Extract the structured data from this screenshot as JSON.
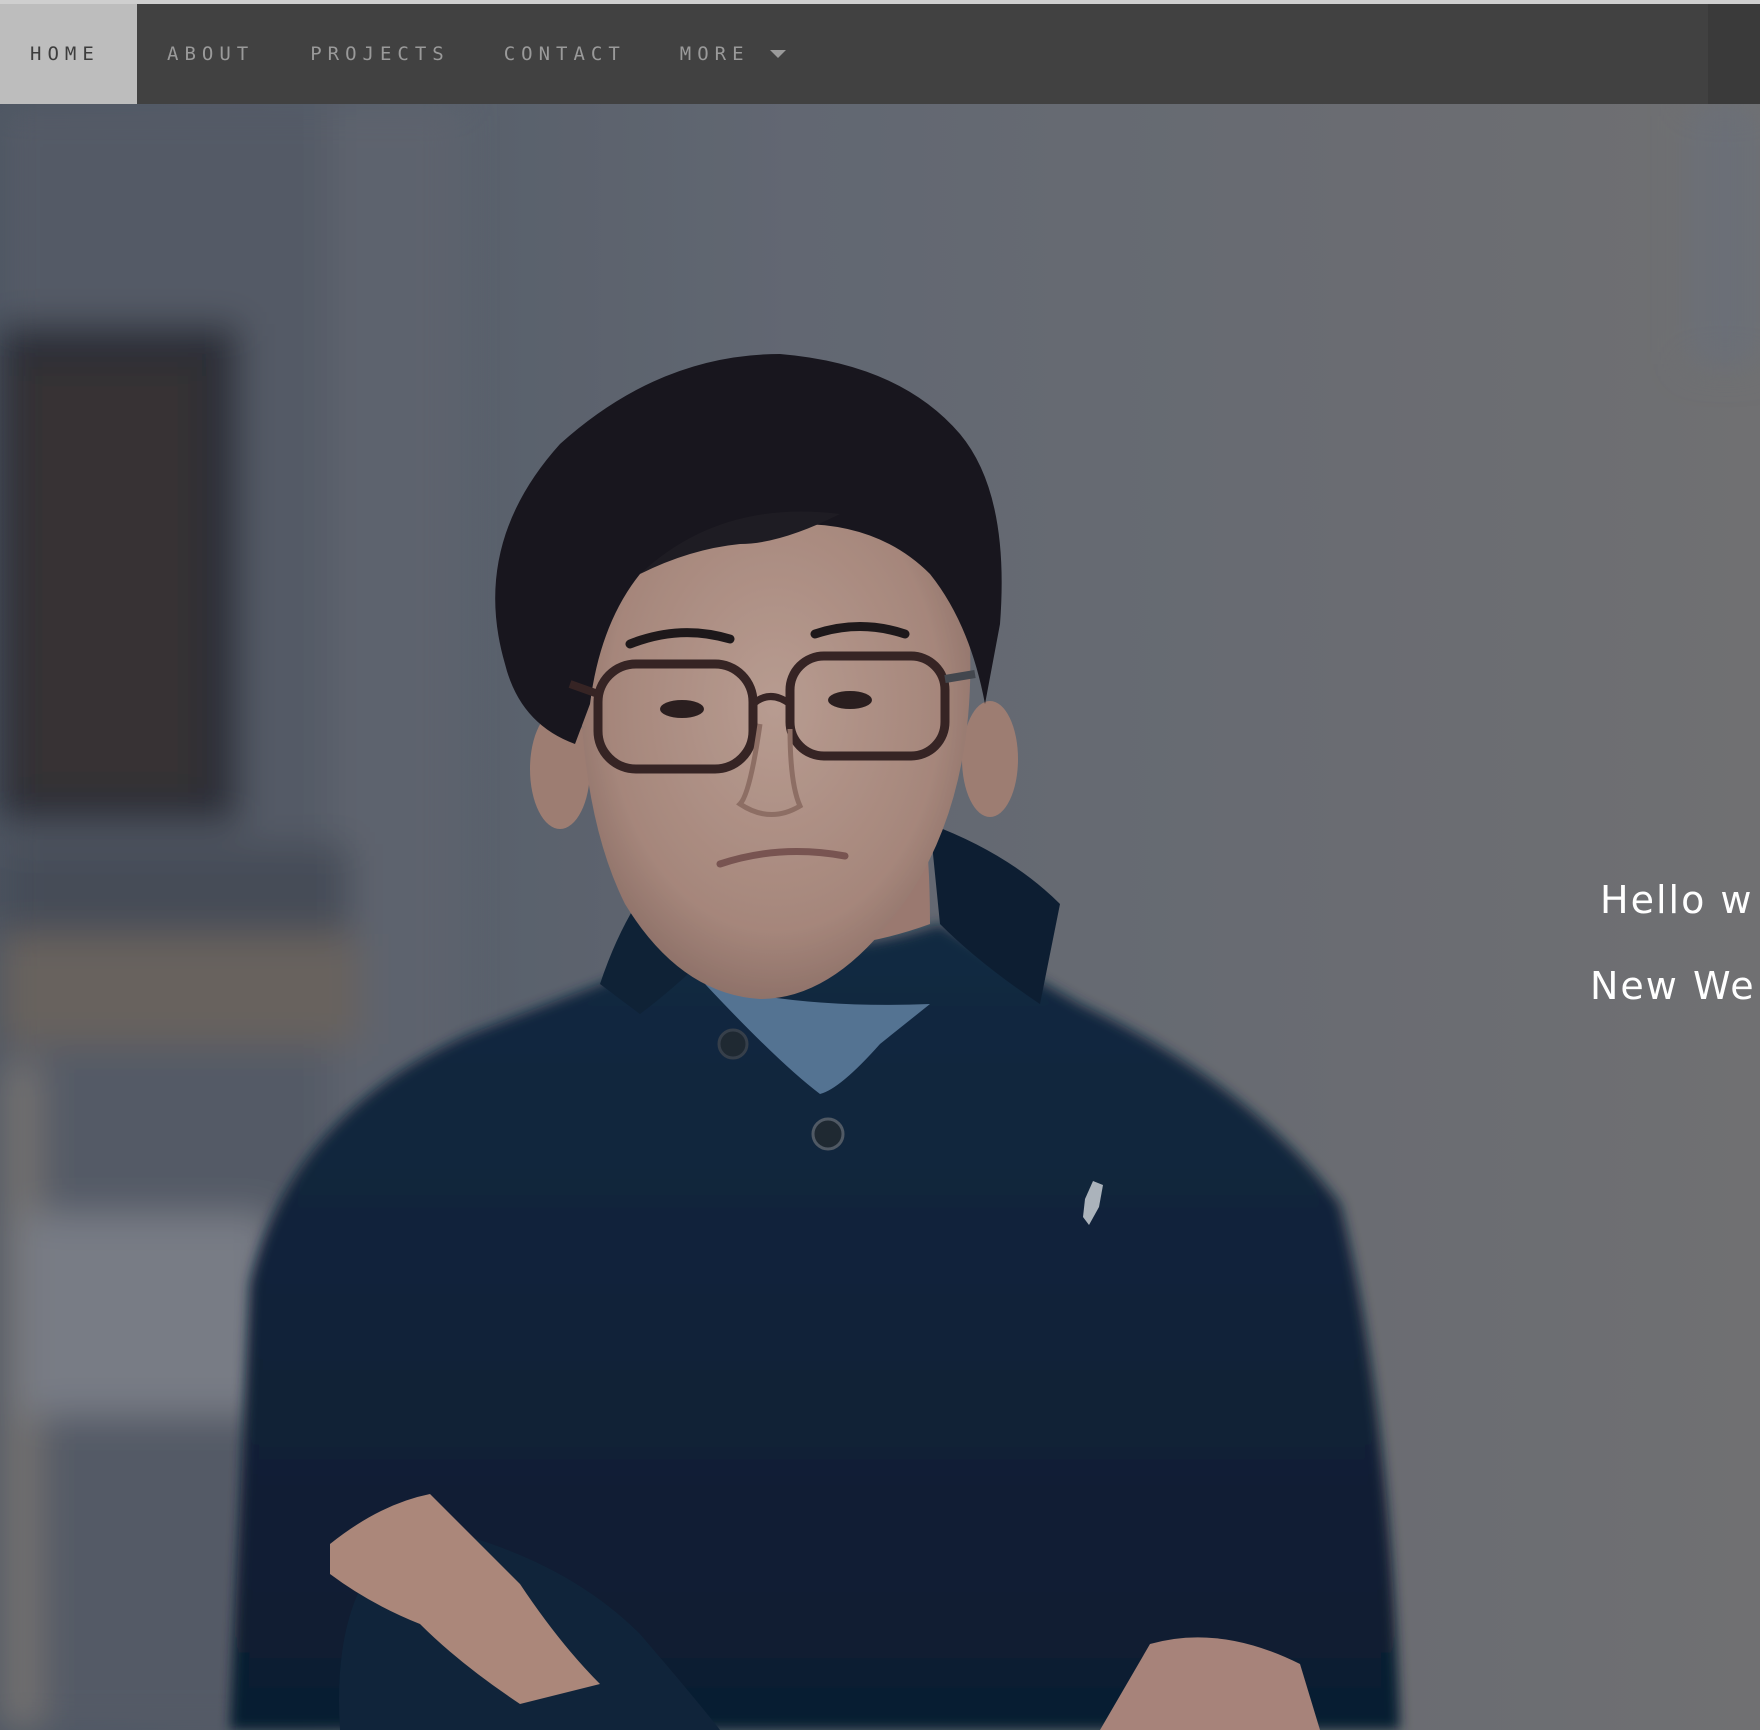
{
  "nav": {
    "items": [
      {
        "label": "HOME",
        "active": true
      },
      {
        "label": "ABOUT"
      },
      {
        "label": "PROJECTS"
      },
      {
        "label": "CONTACT"
      },
      {
        "label": "MORE",
        "dropdown": true
      }
    ]
  },
  "hero": {
    "line1": "Hello w",
    "line2": "New We"
  },
  "colors": {
    "navbar_bg": "#414141",
    "nav_active_bg": "#bdbdbd",
    "nav_text": "#9a9a9a",
    "hero_text": "#ffffff"
  },
  "icons": {
    "more_caret": "chevron-down-icon"
  }
}
